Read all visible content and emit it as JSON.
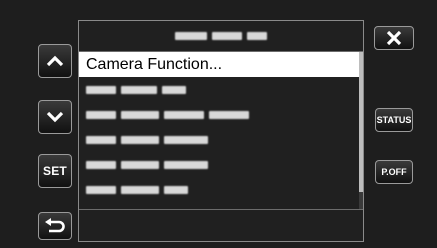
{
  "menu": {
    "title_obscured": true,
    "selected_item": "Camera Function...",
    "items_obscured": [
      {
        "groups": [
          32
        ]
      },
      {
        "groups": [
          32,
          42,
          26
        ]
      },
      {
        "groups": [
          32,
          42,
          36,
          42
        ]
      },
      {
        "groups": [
          32,
          42,
          46
        ]
      },
      {
        "groups": [
          32,
          42,
          46
        ]
      },
      {
        "groups": [
          32,
          42,
          26
        ]
      }
    ],
    "title_groups": [
      32,
      30,
      20
    ]
  },
  "buttons": {
    "set_label": "SET",
    "status_label": "STATUS",
    "poff_label": "P.OFF"
  },
  "icons": {
    "up": "chevron-up-icon",
    "down": "chevron-down-icon",
    "back": "return-arrow-icon",
    "close": "close-x-icon"
  }
}
